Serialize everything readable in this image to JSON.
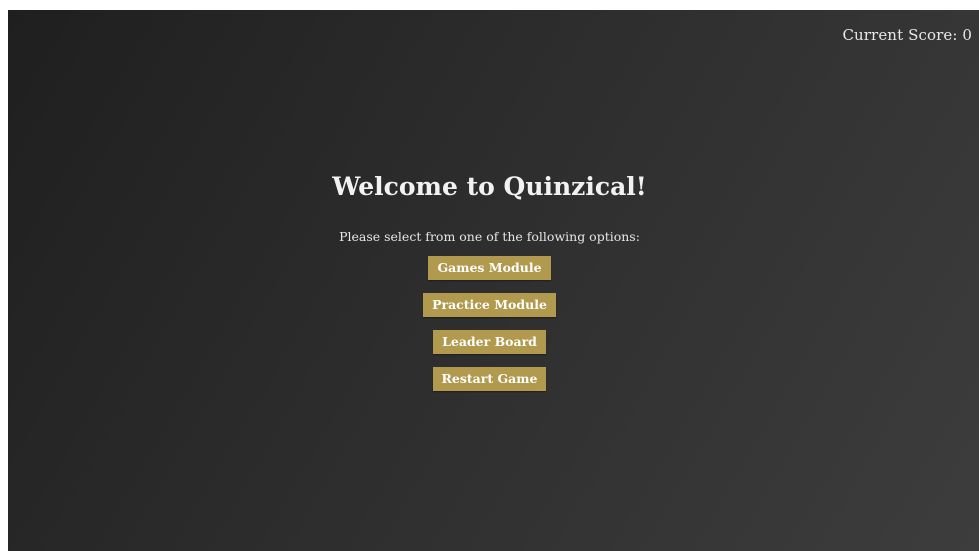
{
  "header": {
    "score_label": "Current Score: 0"
  },
  "main": {
    "title": "Welcome to Quinzical!",
    "instructions": "Please select from one of the following options:",
    "buttons": [
      {
        "label": "Games Module"
      },
      {
        "label": "Practice Module"
      },
      {
        "label": "Leader Board"
      },
      {
        "label": "Restart Game"
      }
    ]
  },
  "colors": {
    "background_dark": "#1f1f1f",
    "background_light": "#3d3d3d",
    "button_gold": "#b19a4e",
    "text_light": "#f2f2f2"
  }
}
